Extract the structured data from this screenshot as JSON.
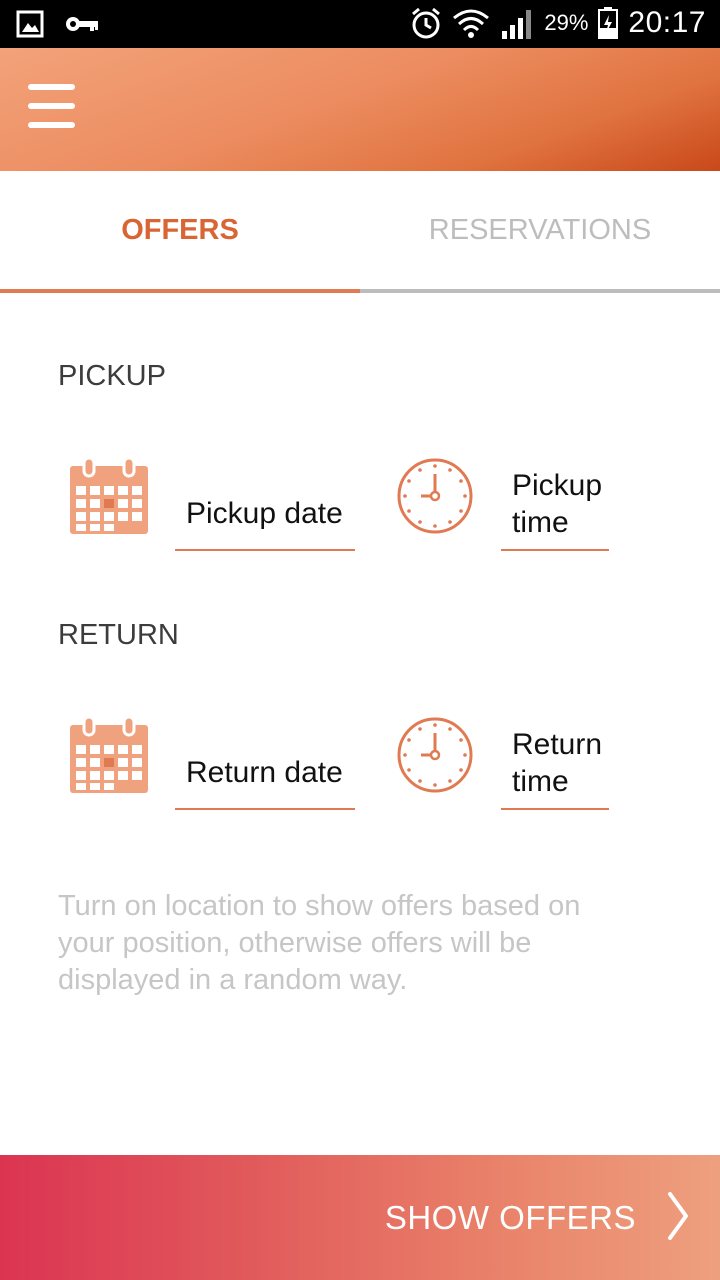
{
  "status_bar": {
    "battery_percent": "29%",
    "time": "20:17",
    "icons": [
      "gallery-icon",
      "key-icon",
      "alarm-icon",
      "wifi-icon",
      "signal-icon",
      "battery-charging-icon"
    ]
  },
  "app_bar": {
    "menu_icon": "hamburger-menu-icon"
  },
  "tabs": [
    {
      "label": "OFFERS",
      "active": true
    },
    {
      "label": "RESERVATIONS",
      "active": false
    }
  ],
  "pickup": {
    "section_label": "PICKUP",
    "date_placeholder": "Pickup date",
    "time_placeholder": "Pickup time"
  },
  "return": {
    "section_label": "RETURN",
    "date_placeholder": "Return date",
    "time_placeholder": "Return time"
  },
  "hint": "Turn on location to show offers based on your position, otherwise offers will be displayed in a random way.",
  "show_offers": {
    "label": "SHOW OFFERS",
    "icon": "chevron-right-icon"
  },
  "colors": {
    "accent": "#e07a52",
    "active_tab": "#d96434",
    "inactive_tab": "#bdbdbd",
    "hint_text": "#c6c6c6"
  }
}
